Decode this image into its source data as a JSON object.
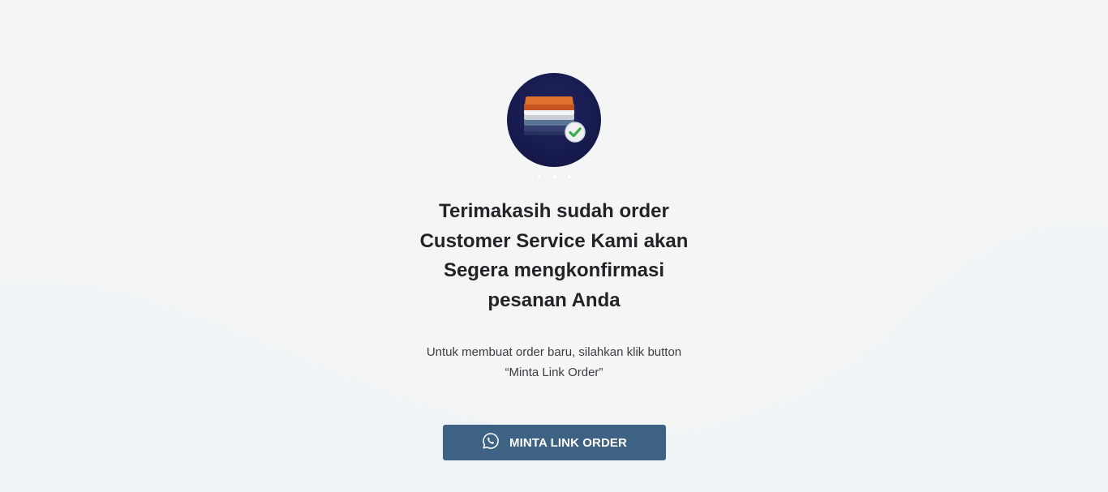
{
  "hero": {
    "image_icon": "folded-clothes-check-icon",
    "carousel_dot_count": 3
  },
  "message": {
    "title_lines": [
      "Terimakasih sudah order",
      "Customer Service Kami akan",
      "Segera mengkonfirmasi",
      "pesanan Anda"
    ],
    "subtitle_lines": [
      "Untuk membuat order baru, silahkan klik button",
      "“Minta Link Order”"
    ]
  },
  "cta": {
    "label": "MINTA LINK ORDER",
    "icon": "whatsapp-icon"
  },
  "colors": {
    "background": "#f4f5f5",
    "button": "#3d6283",
    "avatar": "#16194a",
    "title": "#222326"
  }
}
